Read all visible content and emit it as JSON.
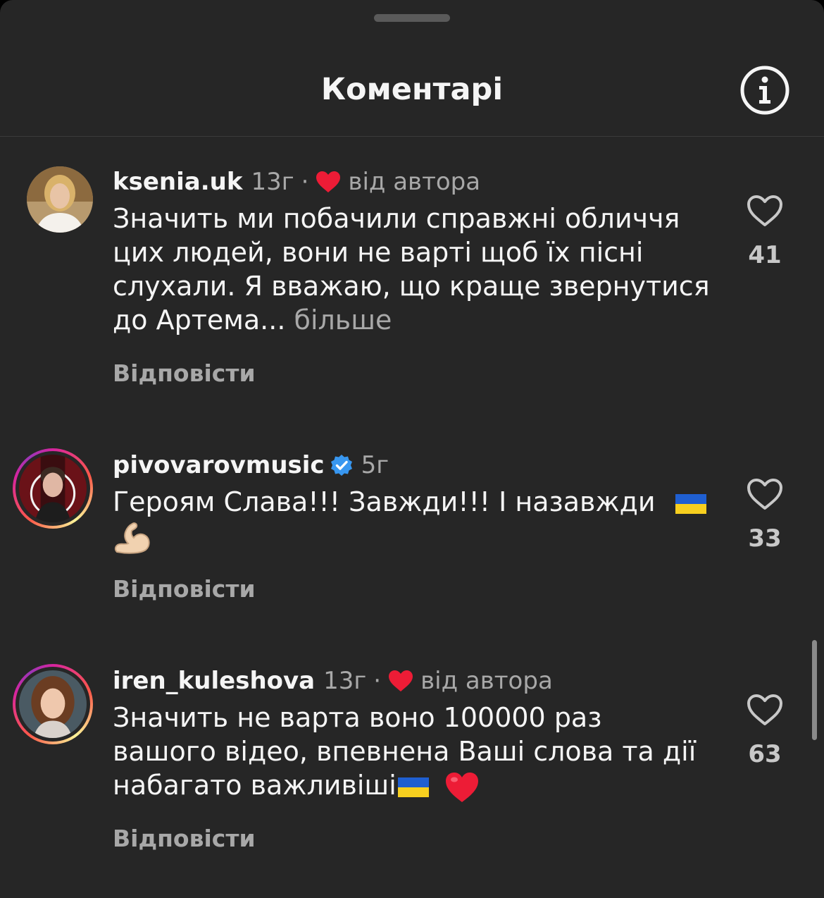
{
  "header": {
    "title": "Коментарі",
    "info_icon": "info-icon"
  },
  "colors": {
    "background": "#262626",
    "heart_red": "#ed1c36",
    "verified_blue": "#3897f0",
    "secondary_text": "#a8a8a8"
  },
  "comments": [
    {
      "username": "ksenia.uk",
      "time": "13г",
      "separator": "·",
      "author_liked": true,
      "author_label": "від автора",
      "text": "Значить ми побачили справжні обличчя цих людей, вони не варті щоб їх пісні слухали. Я вважаю, що краще звернутися до Артема...",
      "more_label": "більше",
      "reply_label": "Відповісти",
      "likes": "41"
    },
    {
      "username": "pivovarovmusic",
      "verified": true,
      "time": "5г",
      "text": "Героям Слава!!! Завжди!!! І назавжди",
      "emojis": [
        "ukraine-flag",
        "flexed-biceps"
      ],
      "reply_label": "Відповісти",
      "likes": "33"
    },
    {
      "username": "iren_kuleshova",
      "time": "13г",
      "separator": "·",
      "author_liked": true,
      "author_label": "від автора",
      "text": "Значить не варта воно 100000 раз вашого відео, впевнена Ваші слова та дії набагато важливіші",
      "emojis": [
        "ukraine-flag",
        "red-heart"
      ],
      "reply_label": "Відповісти",
      "likes": "63"
    }
  ]
}
